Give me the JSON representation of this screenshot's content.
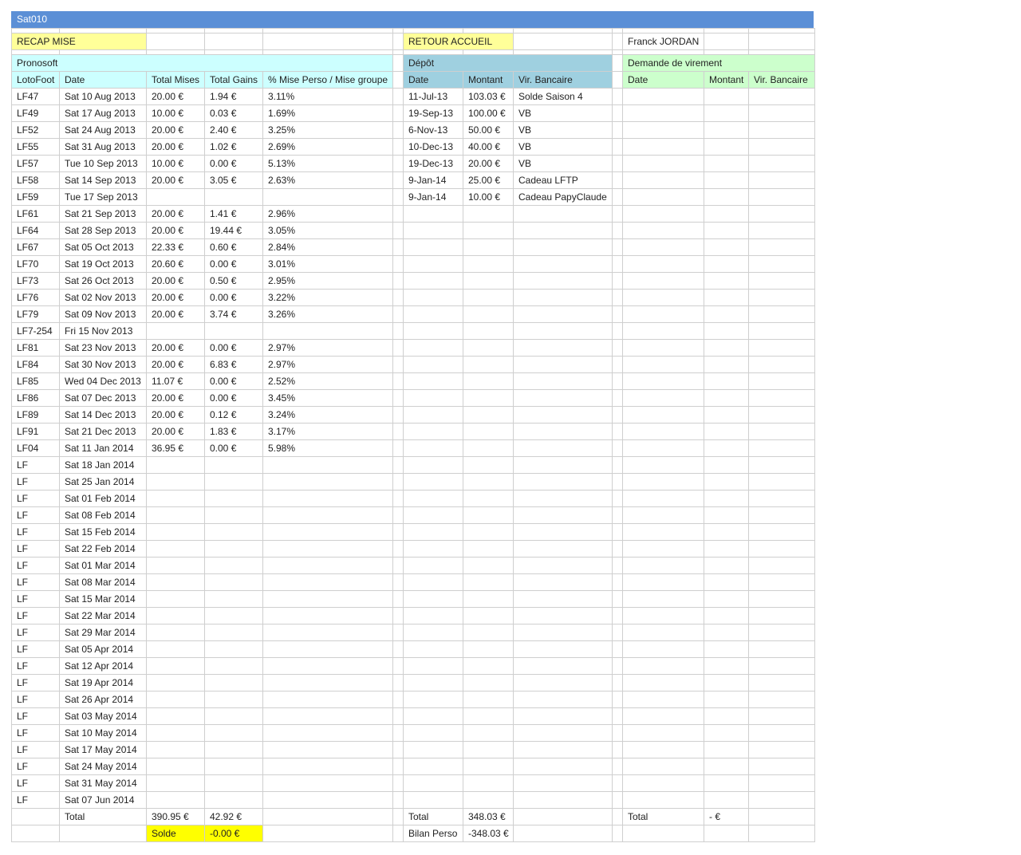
{
  "title": "Sat010",
  "colors": {
    "titlebar": "#5b8fd6",
    "link_bg": "#ffff99",
    "solde_bg": "#ffff00",
    "pronosoft_bg": "#ccffff",
    "depot_bg": "#9fd0e0",
    "virement_bg": "#ccffcc"
  },
  "links": {
    "recap": "RECAP MISE",
    "accueil": "RETOUR ACCUEIL"
  },
  "player_name": "Franck JORDAN",
  "pronosoft": {
    "title": "Pronosoft",
    "headers": [
      "LotoFoot",
      "Date",
      "Total Mises",
      "Total Gains",
      "% Mise Perso / Mise groupe"
    ],
    "rows": [
      [
        "LF47",
        "Sat 10 Aug 2013",
        "20.00 €",
        "1.94 €",
        "3.11%"
      ],
      [
        "LF49",
        "Sat 17 Aug 2013",
        "10.00 €",
        "0.03 €",
        "1.69%"
      ],
      [
        "LF52",
        "Sat 24 Aug 2013",
        "20.00 €",
        "2.40 €",
        "3.25%"
      ],
      [
        "LF55",
        "Sat 31 Aug 2013",
        "20.00 €",
        "1.02 €",
        "2.69%"
      ],
      [
        "LF57",
        "Tue 10 Sep 2013",
        "10.00 €",
        "0.00 €",
        "5.13%"
      ],
      [
        "LF58",
        "Sat 14 Sep 2013",
        "20.00 €",
        "3.05 €",
        "2.63%"
      ],
      [
        "LF59",
        "Tue 17 Sep 2013",
        "",
        "",
        ""
      ],
      [
        "LF61",
        "Sat 21 Sep 2013",
        "20.00 €",
        "1.41 €",
        "2.96%"
      ],
      [
        "LF64",
        "Sat 28 Sep 2013",
        "20.00 €",
        "19.44 €",
        "3.05%"
      ],
      [
        "LF67",
        "Sat 05 Oct 2013",
        "22.33 €",
        "0.60 €",
        "2.84%"
      ],
      [
        "LF70",
        "Sat 19 Oct 2013",
        "20.60 €",
        "0.00 €",
        "3.01%"
      ],
      [
        "LF73",
        "Sat 26 Oct 2013",
        "20.00 €",
        "0.50 €",
        "2.95%"
      ],
      [
        "LF76",
        "Sat 02 Nov 2013",
        "20.00 €",
        "0.00 €",
        "3.22%"
      ],
      [
        "LF79",
        "Sat 09 Nov 2013",
        "20.00 €",
        "3.74 €",
        "3.26%"
      ],
      [
        "LF7-254",
        "Fri 15 Nov 2013",
        "",
        "",
        ""
      ],
      [
        "LF81",
        "Sat 23 Nov 2013",
        "20.00 €",
        "0.00 €",
        "2.97%"
      ],
      [
        "LF84",
        "Sat 30 Nov 2013",
        "20.00 €",
        "6.83 €",
        "2.97%"
      ],
      [
        "LF85",
        "Wed 04 Dec 2013",
        "11.07 €",
        "0.00 €",
        "2.52%"
      ],
      [
        "LF86",
        "Sat 07 Dec 2013",
        "20.00 €",
        "0.00 €",
        "3.45%"
      ],
      [
        "LF89",
        "Sat 14 Dec 2013",
        "20.00 €",
        "0.12 €",
        "3.24%"
      ],
      [
        "LF91",
        "Sat 21 Dec 2013",
        "20.00 €",
        "1.83 €",
        "3.17%"
      ],
      [
        "LF04",
        "Sat 11 Jan 2014",
        "36.95 €",
        "0.00 €",
        "5.98%"
      ],
      [
        "LF",
        "Sat 18 Jan 2014",
        "",
        "",
        ""
      ],
      [
        "LF",
        "Sat 25 Jan 2014",
        "",
        "",
        ""
      ],
      [
        "LF",
        "Sat 01 Feb 2014",
        "",
        "",
        ""
      ],
      [
        "LF",
        "Sat 08 Feb 2014",
        "",
        "",
        ""
      ],
      [
        "LF",
        "Sat 15 Feb 2014",
        "",
        "",
        ""
      ],
      [
        "LF",
        "Sat 22 Feb 2014",
        "",
        "",
        ""
      ],
      [
        "LF",
        "Sat 01 Mar 2014",
        "",
        "",
        ""
      ],
      [
        "LF",
        "Sat 08 Mar 2014",
        "",
        "",
        ""
      ],
      [
        "LF",
        "Sat 15 Mar 2014",
        "",
        "",
        ""
      ],
      [
        "LF",
        "Sat 22 Mar 2014",
        "",
        "",
        ""
      ],
      [
        "LF",
        "Sat 29 Mar 2014",
        "",
        "",
        ""
      ],
      [
        "LF",
        "Sat 05 Apr 2014",
        "",
        "",
        ""
      ],
      [
        "LF",
        "Sat 12 Apr 2014",
        "",
        "",
        ""
      ],
      [
        "LF",
        "Sat 19 Apr 2014",
        "",
        "",
        ""
      ],
      [
        "LF",
        "Sat 26 Apr 2014",
        "",
        "",
        ""
      ],
      [
        "LF",
        "Sat 03 May 2014",
        "",
        "",
        ""
      ],
      [
        "LF",
        "Sat 10 May 2014",
        "",
        "",
        ""
      ],
      [
        "LF",
        "Sat 17 May 2014",
        "",
        "",
        ""
      ],
      [
        "LF",
        "Sat 24 May 2014",
        "",
        "",
        ""
      ],
      [
        "LF",
        "Sat 31 May 2014",
        "",
        "",
        ""
      ],
      [
        "LF",
        "Sat 07 Jun 2014",
        "",
        "",
        ""
      ]
    ],
    "total_label": "Total",
    "total_mises": "390.95 €",
    "total_gains": "42.92 €",
    "solde_label": "Solde",
    "solde_value": "-0.00 €"
  },
  "depot": {
    "title": "Dépôt",
    "headers": [
      "Date",
      "Montant",
      "Vir. Bancaire"
    ],
    "rows": [
      [
        "11-Jul-13",
        "103.03 €",
        "Solde Saison 4"
      ],
      [
        "19-Sep-13",
        "100.00 €",
        "VB"
      ],
      [
        "6-Nov-13",
        "50.00 €",
        "VB"
      ],
      [
        "10-Dec-13",
        "40.00 €",
        "VB"
      ],
      [
        "19-Dec-13",
        "20.00 €",
        "VB"
      ],
      [
        "9-Jan-14",
        "25.00 €",
        "Cadeau LFTP"
      ],
      [
        "9-Jan-14",
        "10.00 €",
        "Cadeau PapyClaude"
      ]
    ],
    "total_label": "Total",
    "total_value": "348.03 €",
    "bilan_label": "Bilan Perso",
    "bilan_value": "-348.03 €"
  },
  "virement": {
    "title": "Demande de virement",
    "headers": [
      "Date",
      "Montant",
      "Vir. Bancaire"
    ],
    "rows": [],
    "total_label": "Total",
    "total_value": "- €"
  }
}
